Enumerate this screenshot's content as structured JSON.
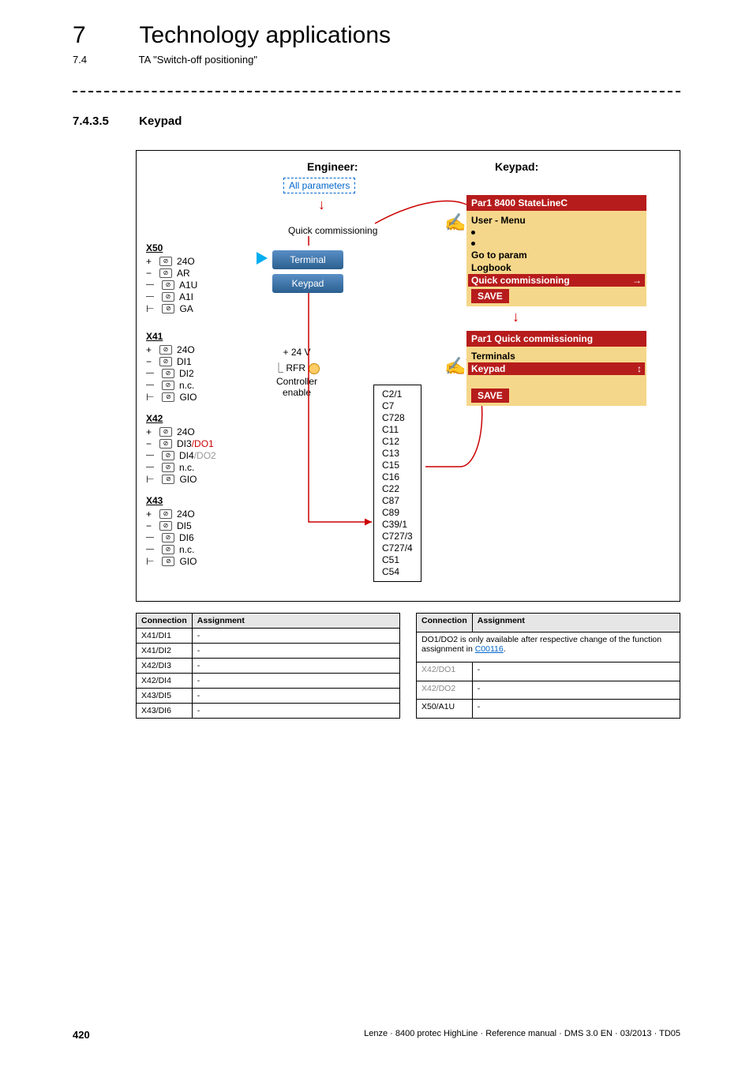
{
  "chapter": {
    "num": "7",
    "title": "Technology applications"
  },
  "sub": {
    "num": "7.4",
    "title": "TA \"Switch-off positioning\""
  },
  "section": {
    "num": "7.4.3.5",
    "title": "Keypad"
  },
  "diagram": {
    "engineer_label": "Engineer:",
    "keypad_label": "Keypad:",
    "all_parameters": "All parameters",
    "quick_commissioning": "Quick commissioning",
    "btn_terminal": "Terminal",
    "btn_keypad": "Keypad",
    "volt": "+ 24 V",
    "rfr": "RFR",
    "controller_enable": "Controller\nenable",
    "terminals": [
      {
        "name": "X50",
        "rows": [
          "24O",
          "AR",
          "A1U",
          "A1I",
          "GA"
        ]
      },
      {
        "name": "X41",
        "rows": [
          "24O",
          "DI1",
          "DI2",
          "n.c.",
          "GIO"
        ]
      },
      {
        "name": "X42",
        "rows": [
          "24O",
          "DI3/DO1",
          "DI4/DO2",
          "n.c.",
          "GIO"
        ]
      },
      {
        "name": "X43",
        "rows": [
          "24O",
          "DI5",
          "DI6",
          "n.c.",
          "GIO"
        ]
      }
    ],
    "code_list": [
      "C2/1",
      "C7",
      "C728",
      "C11",
      "C12",
      "C13",
      "C15",
      "C16",
      "C22",
      "C87",
      "C89",
      "C39/1",
      "C727/3",
      "C727/4",
      "C51",
      "C54"
    ],
    "menu1": {
      "header": "Par1 8400 StateLineC",
      "items": [
        "User - Menu",
        "•",
        "•",
        "Go to param",
        "Logbook"
      ],
      "selected": "Quick commissioning",
      "save": "SAVE"
    },
    "menu2": {
      "header": "Par1 Quick commissioning",
      "items": [
        "Terminals"
      ],
      "selected": "Keypad",
      "save": "SAVE"
    }
  },
  "tables": {
    "left": {
      "headers": [
        "Connection",
        "Assignment"
      ],
      "rows": [
        [
          "X41/DI1",
          "-"
        ],
        [
          "X41/DI2",
          "-"
        ],
        [
          "X42/DI3",
          "-"
        ],
        [
          "X42/DI4",
          "-"
        ],
        [
          "X43/DI5",
          "-"
        ],
        [
          "X43/DI6",
          "-"
        ]
      ]
    },
    "right": {
      "headers": [
        "Connection",
        "Assignment"
      ],
      "note_pre": "DO1/DO2 is only available after respective change of the function assignment in ",
      "note_link": "C00116",
      "note_post": ".",
      "rows": [
        [
          "X42/DO1",
          "-"
        ],
        [
          "X42/DO2",
          "-"
        ],
        [
          "X50/A1U",
          "-"
        ]
      ]
    }
  },
  "footer": {
    "page": "420",
    "text": "Lenze · 8400 protec HighLine · Reference manual · DMS 3.0 EN · 03/2013 · TD05"
  }
}
